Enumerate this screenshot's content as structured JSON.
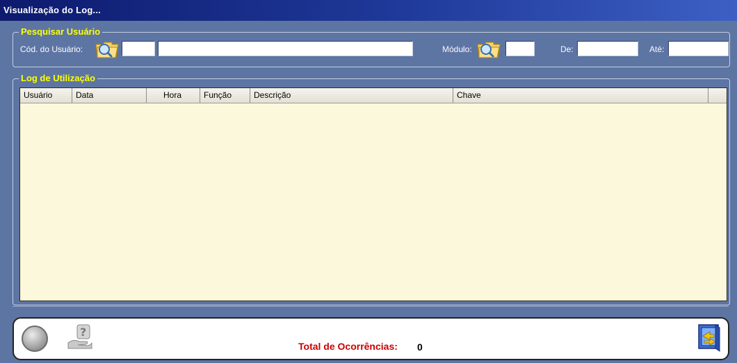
{
  "window": {
    "title": "Visualização do Log..."
  },
  "search_group": {
    "legend": "Pesquisar Usuário",
    "user_code_label": "Cód. do Usuário:",
    "user_code_value": "",
    "user_name_value": "",
    "module_label": "Módulo:",
    "module_value": "",
    "from_label": "De:",
    "from_value": "",
    "to_label": "Até:",
    "to_value": ""
  },
  "log_group": {
    "legend": "Log de Utilização",
    "columns": [
      "Usuário",
      "Data",
      "Hora",
      "Função",
      "Descrição",
      "Chave",
      ""
    ],
    "rows": []
  },
  "footer": {
    "total_label": "Total de Ocorrências:",
    "total_value": "0"
  },
  "icons": {
    "search_folder": "folder-search-icon",
    "circle_button": "circle-icon",
    "help_button": "help-hand-icon",
    "exit_button": "exit-door-icon"
  },
  "colors": {
    "window_bg": "#5d75a3",
    "legend_text": "#ffff00",
    "grid_bg": "#fbf8dc",
    "total_label": "#cc0000"
  }
}
